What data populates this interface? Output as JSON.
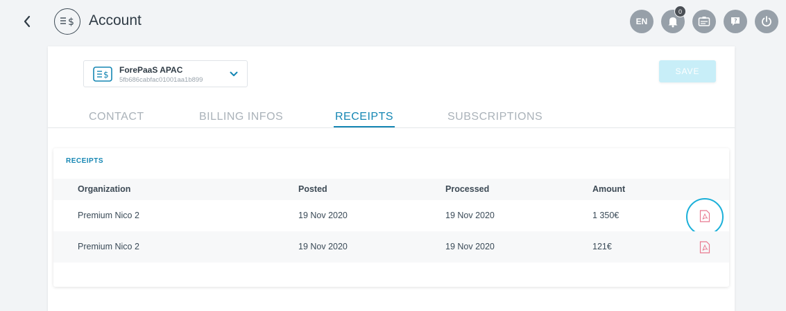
{
  "header": {
    "title": "Account",
    "language": "EN",
    "notifications_count": "0",
    "icons": [
      "back-arrow-icon",
      "account-billing-icon",
      "bell-icon",
      "id-card-icon",
      "help-icon",
      "power-icon"
    ]
  },
  "org_selector": {
    "name": "ForePaaS APAC",
    "id": "5fb686cabfac01001aa1b899"
  },
  "toolbar": {
    "save_label": "SAVE"
  },
  "tabs": [
    {
      "label": "CONTACT"
    },
    {
      "label": "BILLING INFOS"
    },
    {
      "label": "RECEIPTS",
      "active": true
    },
    {
      "label": "SUBSCRIPTIONS"
    }
  ],
  "receipts": {
    "title": "RECEIPTS",
    "columns": [
      "Organization",
      "Posted",
      "Processed",
      "Amount"
    ],
    "rows": [
      {
        "organization": "Premium Nico 2",
        "posted": "19 Nov 2020",
        "processed": "19 Nov 2020",
        "amount": "1 350€"
      },
      {
        "organization": "Premium Nico 2",
        "posted": "19 Nov 2020",
        "processed": "19 Nov 2020",
        "amount": "121€"
      }
    ]
  },
  "colors": {
    "accent": "#1486b3",
    "save_disabled": "#c8eef8",
    "pdf_icon": "#e8788f",
    "focus_ring": "#1bb0d9"
  }
}
